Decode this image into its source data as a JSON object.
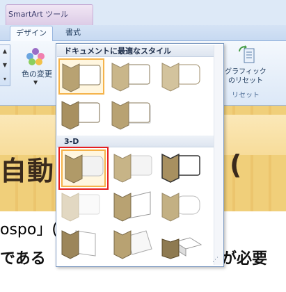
{
  "window": {
    "context_tab_group": "SmartArt ツール"
  },
  "tabs": [
    {
      "label": "デザイン",
      "selected": true
    },
    {
      "label": "書式",
      "selected": false
    }
  ],
  "ribbon": {
    "color_change": {
      "label": "色の変更",
      "icon": "palette-icon"
    },
    "reset": {
      "label_line1": "グラフィック",
      "label_line2": "のリセット",
      "group_label": "リセット",
      "icon": "reset-graphic-icon"
    }
  },
  "gallery": {
    "section_document": "ドキュメントに最適なスタイル",
    "section_3d": "3-D",
    "document_styles": [
      {
        "name": "style-simple"
      },
      {
        "name": "style-subtle"
      },
      {
        "name": "style-moderate"
      },
      {
        "name": "style-intense"
      },
      {
        "name": "style-shadow"
      }
    ],
    "styles_3d": [
      {
        "name": "style-3d-polished"
      },
      {
        "name": "style-3d-inset"
      },
      {
        "name": "style-3d-cartoon"
      },
      {
        "name": "style-3d-powder"
      },
      {
        "name": "style-3d-brick"
      },
      {
        "name": "style-3d-flat"
      },
      {
        "name": "style-3d-metallic"
      },
      {
        "name": "style-3d-sunset"
      },
      {
        "name": "style-3d-bird"
      }
    ],
    "selected_document_style": 0,
    "highlighted_3d_style": 0
  },
  "document": {
    "heading_left": "自動",
    "heading_right": "(",
    "body_line1_left": "ospo」(",
    "body_line1_right": "",
    "body_line2_left": "である",
    "body_line2_right": "が必要"
  },
  "colors": {
    "chevron": "#b8a272",
    "shape_fill": "#ffffff",
    "highlight_red": "#e52020",
    "selected_orange": "#f5b34a"
  }
}
